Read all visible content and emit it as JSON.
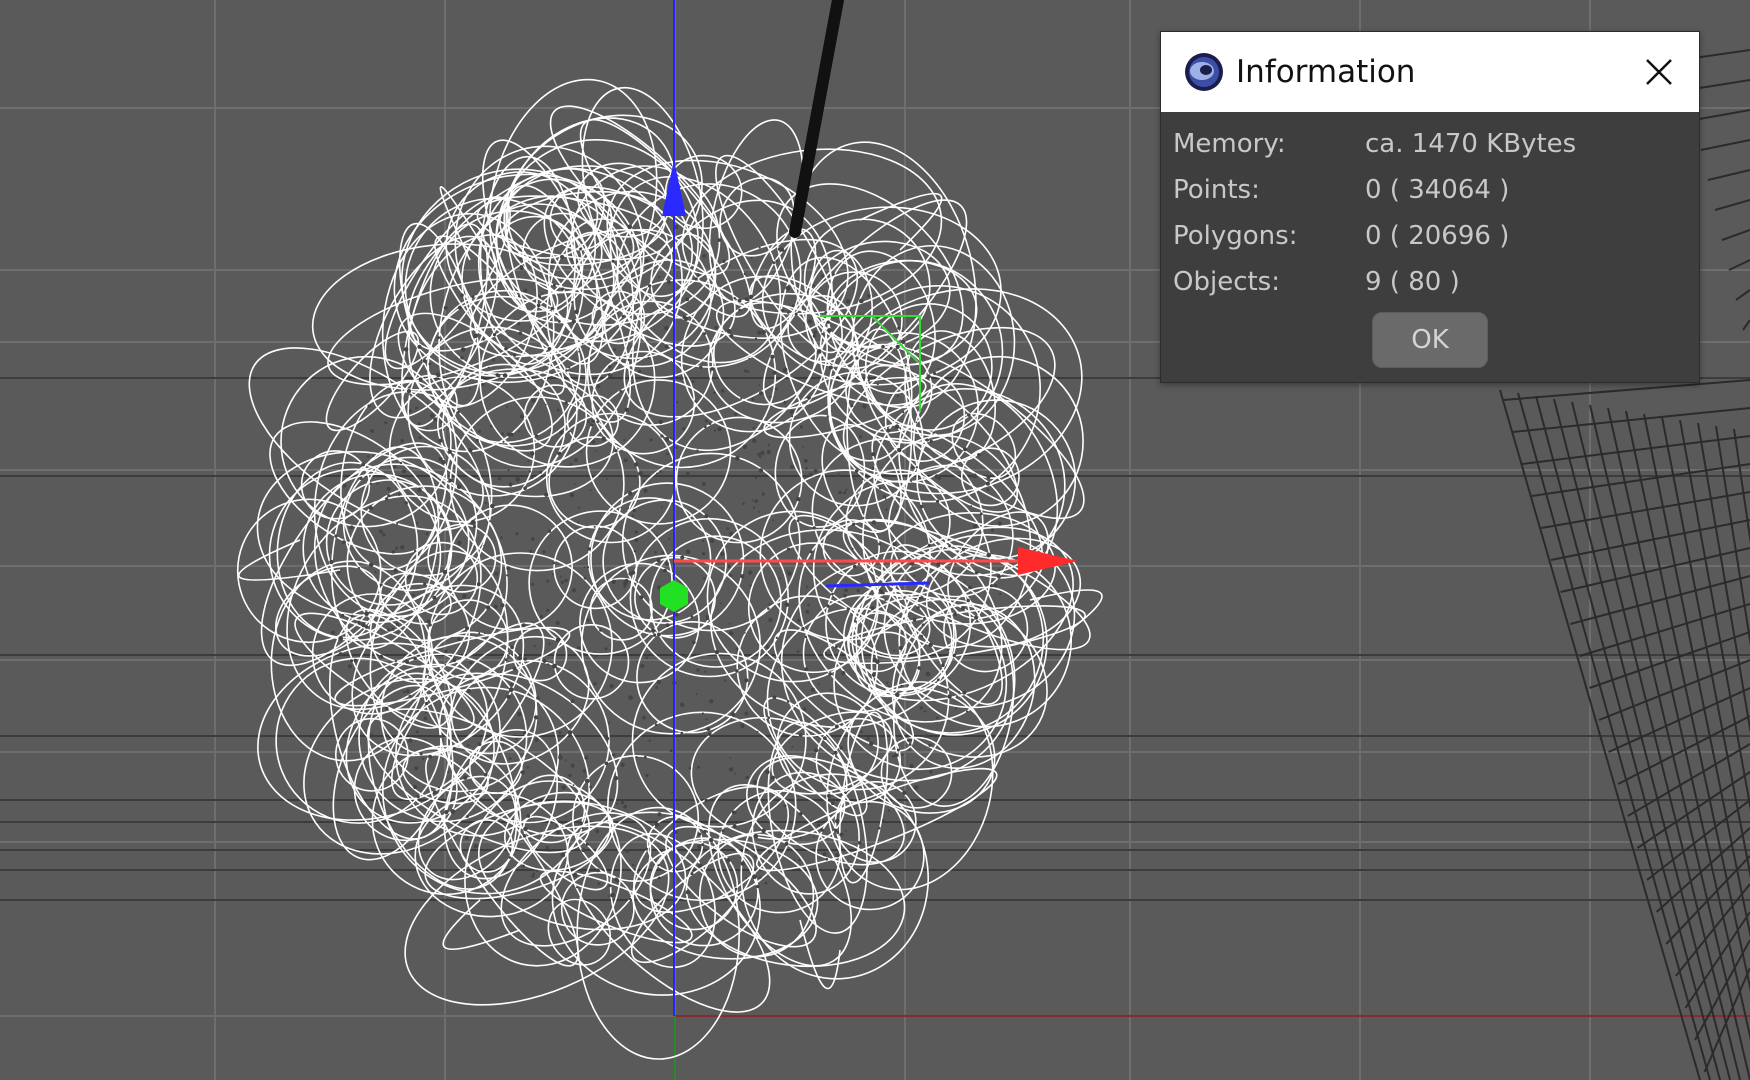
{
  "dialog": {
    "title": "Information",
    "rows": [
      {
        "label": "Memory:",
        "value": "ca. 1470 KBytes"
      },
      {
        "label": "Points:",
        "value": "0 ( 34064 )"
      },
      {
        "label": "Polygons:",
        "value": "0 ( 20696 )"
      },
      {
        "label": "Objects:",
        "value": "9 ( 80 )"
      }
    ],
    "ok_label": "OK"
  },
  "viewport": {
    "background_color": "#5a5a5a",
    "grid_color": "#6a6a6a",
    "dark_grid_color": "#3a3a3a",
    "wireframe_color": "#ffffff",
    "axis_colors": {
      "x": "#ff3030",
      "y": "#2020ff",
      "z": "#20e020"
    },
    "icons": [
      "cinema4d-app-icon",
      "close-icon",
      "move-gizmo-icon"
    ]
  }
}
